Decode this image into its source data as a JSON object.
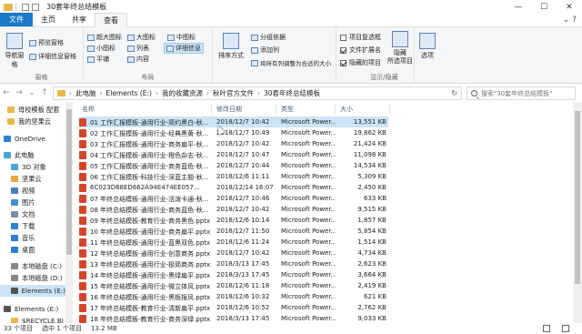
{
  "window": {
    "title": "30套年终总结模板"
  },
  "ribbon_tabs": [
    {
      "label": "文件"
    },
    {
      "label": "主页"
    },
    {
      "label": "共享"
    },
    {
      "label": "查看"
    }
  ],
  "ribbon": {
    "panes": {
      "nav_pane": "导航窗格",
      "preview_pane": "预览窗格",
      "details_pane": "详细信息窗格",
      "label": "窗格"
    },
    "layout": {
      "items": [
        "超大图标",
        "大图标",
        "中图标",
        "小图标",
        "列表",
        "详细信息",
        "平铺",
        "内容"
      ],
      "label": "布局"
    },
    "current_view": {
      "sort": "排序方式",
      "group": "分组依据",
      "add_column": "添加列",
      "fit_columns": "将所有列调整为合适的大小"
    },
    "show_hide": {
      "item_checkbox": "项目复选框",
      "file_ext": "文件扩展名",
      "hidden_items": "隐藏的项目",
      "hide_selected": "隐藏\n所选项目",
      "label": "显示/隐藏"
    },
    "options": "选项"
  },
  "address": {
    "crumbs": [
      "此电脑",
      "Elements (E:)",
      "我的收藏资源",
      "秋叶官方文件",
      "30套年终总结模板"
    ],
    "search_placeholder": "搜索\"30套年终总结模板\""
  },
  "nav": {
    "items": [
      {
        "label": "母校模板 配套",
        "color": "#e8b84a"
      },
      {
        "label": "我的坚果云",
        "color": "#e8b84a"
      },
      {
        "label": "OneDrive",
        "color": "#2d7fd6"
      },
      {
        "label": "此电脑",
        "color": "#4aa3df"
      },
      {
        "label": "3D 对象",
        "color": "#4aa3df"
      },
      {
        "label": "坚果云",
        "color": "#e8a83a"
      },
      {
        "label": "视频",
        "color": "#4a7fb8"
      },
      {
        "label": "图片",
        "color": "#4a90c8"
      },
      {
        "label": "文档",
        "color": "#7a8fa8"
      },
      {
        "label": "下载",
        "color": "#2d7fd6"
      },
      {
        "label": "音乐",
        "color": "#2d7fd6"
      },
      {
        "label": "桌面",
        "color": "#2d7fd6"
      },
      {
        "label": "本地磁盘 (C:)",
        "color": "#888888"
      },
      {
        "label": "本地磁盘 (D:)",
        "color": "#888888"
      },
      {
        "label": "Elements (E:)",
        "color": "#555555"
      },
      {
        "label": "Elements (E:)",
        "color": "#555555"
      },
      {
        "label": "$RECYCLE.BI",
        "color": "#e8b84a"
      }
    ]
  },
  "columns": {
    "name": "名称",
    "date": "修改日期",
    "type": "类型",
    "size": "大小"
  },
  "files": [
    {
      "name": "01 工作汇报模板-通用行业-简约黑白-秋...",
      "date": "2018/12/7 10:42",
      "type": "Microsoft Power...",
      "size": "13,551 KB"
    },
    {
      "name": "02 工作汇报模板-通用行业-经典黑黄-秋...",
      "date": "2018/12/7 10:49",
      "type": "Microsoft Power...",
      "size": "19,862 KB"
    },
    {
      "name": "03 工作汇报模板-通用行业-商务扁平-秋...",
      "date": "2018/12/7 10:42",
      "type": "Microsoft Power...",
      "size": "21,424 KB"
    },
    {
      "name": "04 工作汇报模板-通用行业-橙色杂志-秋...",
      "date": "2018/12/7 10:47",
      "type": "Microsoft Power...",
      "size": "11,098 KB"
    },
    {
      "name": "05 工作汇报模板-通用行业-商务蓝色-秋...",
      "date": "2018/12/7 10:44",
      "type": "Microsoft Power...",
      "size": "14,534 KB"
    },
    {
      "name": "06 工作汇报模板-科技行业-深蓝主题-秋...",
      "date": "2018/12/6 11:11",
      "type": "Microsoft Power...",
      "size": "5,309 KB"
    },
    {
      "name": "6C023D88ED662A94E474EE057...",
      "date": "2018/12/14 16:07",
      "type": "Microsoft Power...",
      "size": "2,450 KB"
    },
    {
      "name": "07 年终总结模板-通用行业-活泼卡通-秋...",
      "date": "2018/12/7 10:46",
      "type": "Microsoft Power...",
      "size": "633 KB"
    },
    {
      "name": "08 年终总结模板-通用行业-商务蓝色-秋...",
      "date": "2018/12/7 10:42",
      "type": "Microsoft Power...",
      "size": "9,515 KB"
    },
    {
      "name": "09 年终总结模板-教育行业-商务黑色.pptx",
      "date": "2018/12/6 10:14",
      "type": "Microsoft Power...",
      "size": "1,857 KB"
    },
    {
      "name": "10 年终总结模板-通用行业-商务扁平.pptx",
      "date": "2018/12/7 11:50",
      "type": "Microsoft Power...",
      "size": "5,854 KB"
    },
    {
      "name": "11 年终总结模板-通用行业-蓝黑双色.pptx",
      "date": "2018/12/6 11:24",
      "type": "Microsoft Power...",
      "size": "1,514 KB"
    },
    {
      "name": "12 年终总结模板-通用行业-创意商务.pptx",
      "date": "2018/12/7 10:42",
      "type": "Microsoft Power...",
      "size": "4,734 KB"
    },
    {
      "name": "13 年终总结模板-通用行业-极简商务.pptx",
      "date": "2018/3/13 17:45",
      "type": "Microsoft Power...",
      "size": "2,623 KB"
    },
    {
      "name": "14 年终总结模板-通用行业-黑绿扁平.pptx",
      "date": "2018/3/13 17:45",
      "type": "Microsoft Power...",
      "size": "3,664 KB"
    },
    {
      "name": "15 年终总结模板-通用行业-微立体风.pptx",
      "date": "2018/12/6 11:18",
      "type": "Microsoft Power...",
      "size": "2,419 KB"
    },
    {
      "name": "16 年终总结模板-通用行业-黑板报风.pptx",
      "date": "2018/12/6 10:32",
      "type": "Microsoft Power...",
      "size": "621 KB"
    },
    {
      "name": "17 年终总结模板-教育行业-清新扁平.pptx",
      "date": "2018/12/6 10:52",
      "type": "Microsoft Power...",
      "size": "2,762 KB"
    },
    {
      "name": "18 年终总结模板-教育行业-商务深绿.pptx",
      "date": "2018/3/13 17:45",
      "type": "Microsoft Power...",
      "size": "9,033 KB"
    }
  ],
  "status": {
    "count": "33 个项目",
    "selected": "选中 1 个项目",
    "size": "13.2 MB"
  }
}
